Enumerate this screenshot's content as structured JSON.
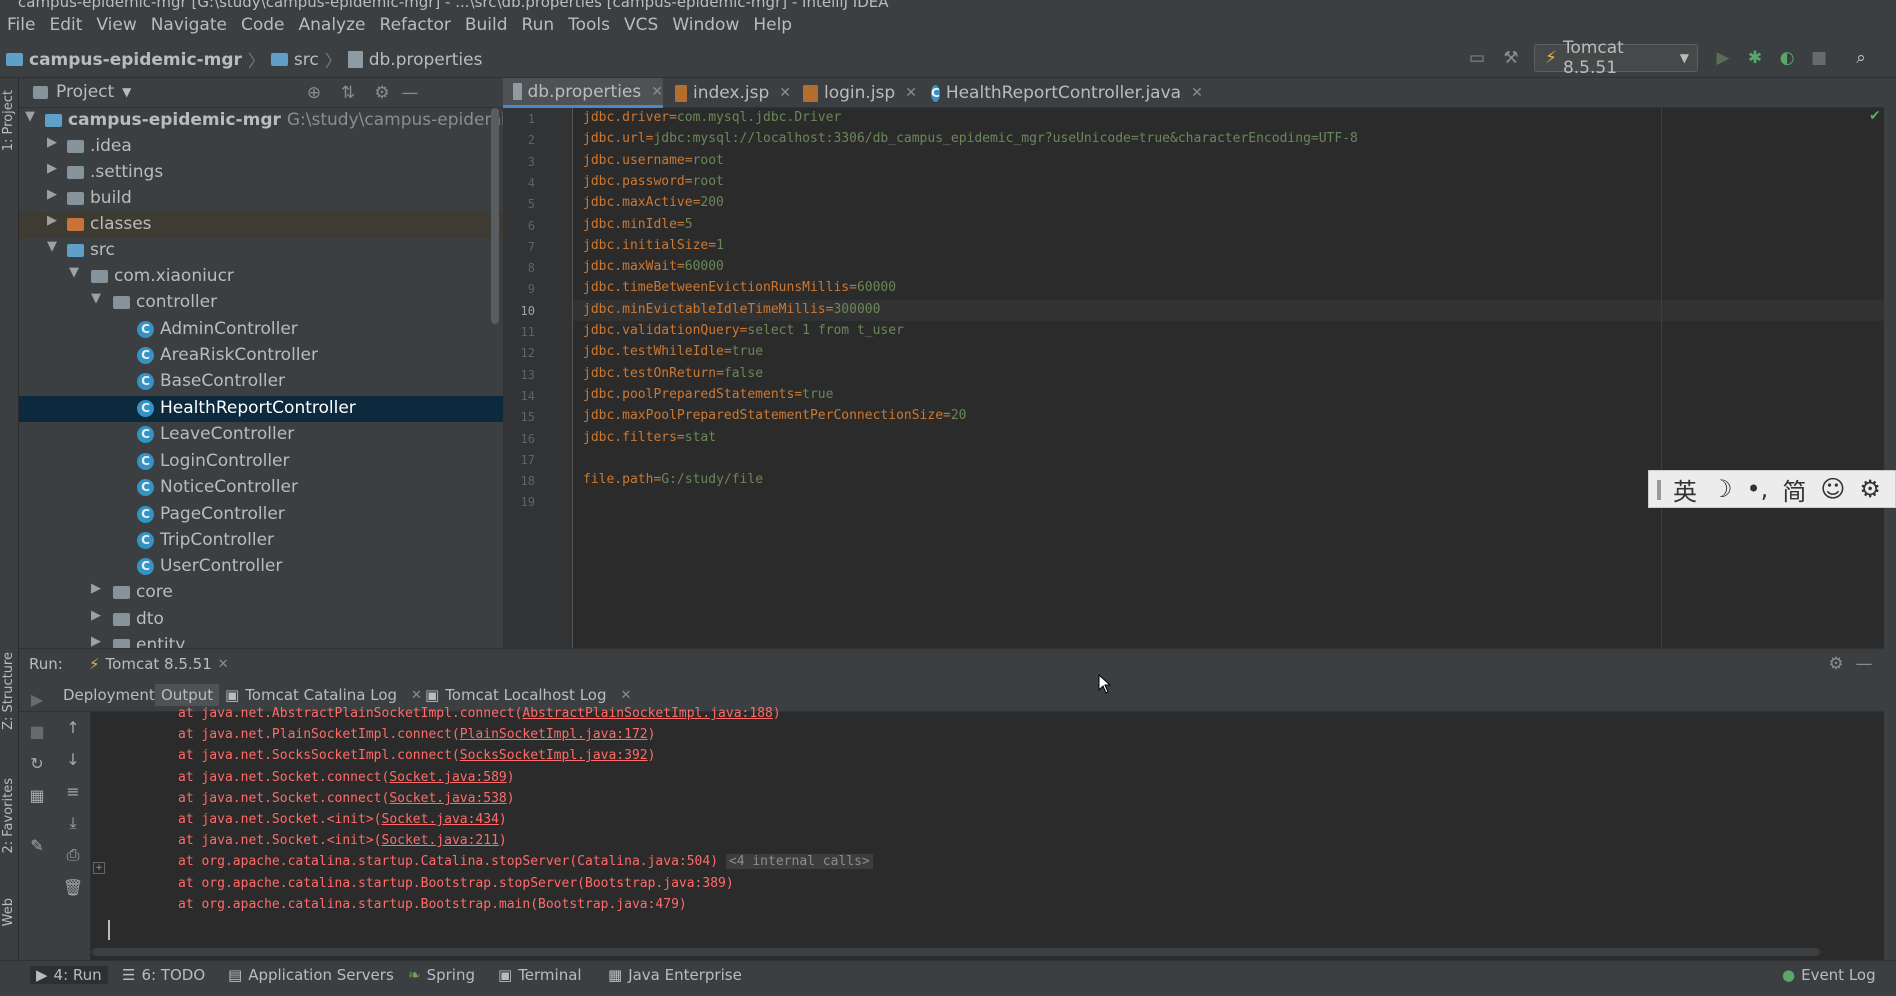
{
  "window": {
    "title": "campus-epidemic-mgr [G:\\study\\campus-epidemic-mgr] - ...\\src\\db.properties [campus-epidemic-mgr] - IntelliJ IDEA"
  },
  "menu": [
    "File",
    "Edit",
    "View",
    "Navigate",
    "Code",
    "Analyze",
    "Refactor",
    "Build",
    "Run",
    "Tools",
    "VCS",
    "Window",
    "Help"
  ],
  "breadcrumb": {
    "project": "campus-epidemic-mgr",
    "folder": "src",
    "file": "db.properties"
  },
  "run_config": "Tomcat 8.5.51",
  "left_strip": {
    "project": "1: Project",
    "structure": "Z: Structure",
    "favorites": "2: Favorites",
    "web": "Web"
  },
  "project_panel": {
    "title": "Project",
    "root": {
      "name": "campus-epidemic-mgr",
      "path": "G:\\study\\campus-epidemic-mgr"
    },
    "items": [
      {
        "label": ".idea"
      },
      {
        "label": ".settings"
      },
      {
        "label": "build"
      },
      {
        "label": "classes"
      },
      {
        "label": "src"
      },
      {
        "label": "com.xiaoniucr"
      },
      {
        "label": "controller"
      },
      {
        "label": "AdminController"
      },
      {
        "label": "AreaRiskController"
      },
      {
        "label": "BaseController"
      },
      {
        "label": "HealthReportController"
      },
      {
        "label": "LeaveController"
      },
      {
        "label": "LoginController"
      },
      {
        "label": "NoticeController"
      },
      {
        "label": "PageController"
      },
      {
        "label": "TripController"
      },
      {
        "label": "UserController"
      },
      {
        "label": "core"
      },
      {
        "label": "dto"
      },
      {
        "label": "entity"
      }
    ]
  },
  "editor_tabs": [
    {
      "label": "db.properties"
    },
    {
      "label": "index.jsp"
    },
    {
      "label": "login.jsp"
    },
    {
      "label": "HealthReportController.java"
    }
  ],
  "code": [
    {
      "n": "1",
      "k": "jdbc.driver",
      "v": "com.mysql.jdbc.Driver"
    },
    {
      "n": "2",
      "k": "jdbc.url",
      "v": "jdbc:mysql://localhost:3306/db_campus_epidemic_mgr?useUnicode=true&characterEncoding=UTF-8"
    },
    {
      "n": "3",
      "k": "jdbc.username",
      "v": "root"
    },
    {
      "n": "4",
      "k": "jdbc.password",
      "v": "root"
    },
    {
      "n": "5",
      "k": "jdbc.maxActive",
      "v": "200"
    },
    {
      "n": "6",
      "k": "jdbc.minIdle",
      "v": "5"
    },
    {
      "n": "7",
      "k": "jdbc.initialSize",
      "v": "1"
    },
    {
      "n": "8",
      "k": "jdbc.maxWait",
      "v": "60000"
    },
    {
      "n": "9",
      "k": "jdbc.timeBetweenEvictionRunsMillis",
      "v": "60000"
    },
    {
      "n": "10",
      "k": "jdbc.minEvictableIdleTimeMillis",
      "v": "300000"
    },
    {
      "n": "11",
      "k": "jdbc.validationQuery",
      "v": "select 1 from t_user"
    },
    {
      "n": "12",
      "k": "jdbc.testWhileIdle",
      "v": "true"
    },
    {
      "n": "13",
      "k": "jdbc.testOnReturn",
      "v": "false"
    },
    {
      "n": "14",
      "k": "jdbc.poolPreparedStatements",
      "v": "true"
    },
    {
      "n": "15",
      "k": "jdbc.maxPoolPreparedStatementPerConnectionSize",
      "v": "20"
    },
    {
      "n": "16",
      "k": "jdbc.filters",
      "v": "stat"
    },
    {
      "n": "17",
      "k": "",
      "v": ""
    },
    {
      "n": "18",
      "k": "file.path",
      "v": "G:/study/file"
    },
    {
      "n": "19",
      "k": "",
      "v": ""
    }
  ],
  "ime_toolbar": [
    "英",
    "☽",
    "•,",
    "简",
    "☺",
    "⚙"
  ],
  "run_panel": {
    "label": "Run:",
    "config": "Tomcat 8.5.51",
    "tabs": [
      "Deployment",
      "Output",
      "Tomcat Catalina Log",
      "Tomcat Localhost Log"
    ]
  },
  "console": [
    {
      "pre": "at java.net.AbstractPlainSocketImpl.connect(",
      "link": "AbstractPlainSocketImpl.java:188",
      "post": ")"
    },
    {
      "pre": "at java.net.PlainSocketImpl.connect(",
      "link": "PlainSocketImpl.java:172",
      "post": ")"
    },
    {
      "pre": "at java.net.SocksSocketImpl.connect(",
      "link": "SocksSocketImpl.java:392",
      "post": ")"
    },
    {
      "pre": "at java.net.Socket.connect(",
      "link": "Socket.java:589",
      "post": ")"
    },
    {
      "pre": "at java.net.Socket.connect(",
      "link": "Socket.java:538",
      "post": ")"
    },
    {
      "pre": "at java.net.Socket.<init>(",
      "link": "Socket.java:434",
      "post": ")"
    },
    {
      "pre": "at java.net.Socket.<init>(",
      "link": "Socket.java:211",
      "post": ")"
    },
    {
      "pre": "at org.apache.catalina.startup.Catalina.stopServer(Catalina.java:504)",
      "link": "",
      "post": "",
      "internal": "<4 internal calls>"
    },
    {
      "pre": "at org.apache.catalina.startup.Bootstrap.stopServer(Bootstrap.java:389)",
      "link": "",
      "post": ""
    },
    {
      "pre": "at org.apache.catalina.startup.Bootstrap.main(Bootstrap.java:479)",
      "link": "",
      "post": ""
    }
  ],
  "bottom_tools": [
    {
      "label": "4: Run"
    },
    {
      "label": "6: TODO"
    },
    {
      "label": "Application Servers"
    },
    {
      "label": "Spring"
    },
    {
      "label": "Terminal"
    },
    {
      "label": "Java Enterprise"
    },
    {
      "label": "Event Log"
    }
  ],
  "colors": {
    "accent": "#4a88c7",
    "key": "#cc7832",
    "value": "#6a8759",
    "error": "#ff6b68",
    "selection": "#0d293e"
  }
}
